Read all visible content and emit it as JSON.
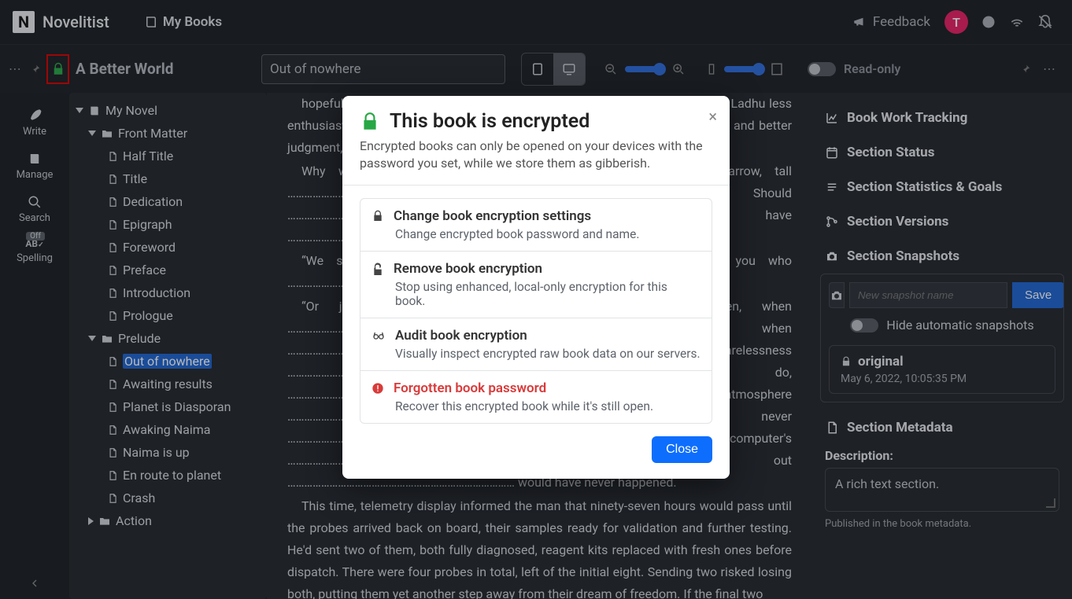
{
  "brand": "Novelitist",
  "my_books": "My Books",
  "feedback": "Feedback",
  "avatar_initial": "T",
  "book_title": "A Better World",
  "chapter_field": "Out of nowhere",
  "readonly_label": "Read-only",
  "rail": {
    "write": "Write",
    "manage": "Manage",
    "search": "Search",
    "spelling": "Spelling",
    "spelling_badge": "Off"
  },
  "tree": [
    {
      "type": "book",
      "label": "My Novel",
      "depth": 0
    },
    {
      "type": "folder",
      "label": "Front Matter",
      "depth": 1
    },
    {
      "type": "doc",
      "label": "Half Title",
      "depth": 2
    },
    {
      "type": "doc",
      "label": "Title",
      "depth": 2
    },
    {
      "type": "doc",
      "label": "Dedication",
      "depth": 2
    },
    {
      "type": "doc",
      "label": "Epigraph",
      "depth": 2
    },
    {
      "type": "doc",
      "label": "Foreword",
      "depth": 2
    },
    {
      "type": "doc",
      "label": "Preface",
      "depth": 2
    },
    {
      "type": "doc",
      "label": "Introduction",
      "depth": 2
    },
    {
      "type": "doc",
      "label": "Prologue",
      "depth": 2
    },
    {
      "type": "folder",
      "label": "Prelude",
      "depth": 1
    },
    {
      "type": "doc",
      "label": "Out of nowhere",
      "depth": 2,
      "selected": true
    },
    {
      "type": "doc",
      "label": "Awaiting results",
      "depth": 2
    },
    {
      "type": "doc",
      "label": "Planet is Diasporan",
      "depth": 2
    },
    {
      "type": "doc",
      "label": "Awaking Naima",
      "depth": 2
    },
    {
      "type": "doc",
      "label": "Naima is up",
      "depth": 2
    },
    {
      "type": "doc",
      "label": "En route to planet",
      "depth": 2
    },
    {
      "type": "doc",
      "label": "Crash",
      "depth": 2
    },
    {
      "type": "folder",
      "label": "Action",
      "depth": 1,
      "collapsed": true
    }
  ],
  "content_paragraphs": [
    "hopefulness and in more frequent, and more honest, reality checks. It made Ladhu less enthusiastic, that was hard to miss, but Naima never let the hope completely, and better judgment, the time.",
    "Why wait ……………………………………………………………………………… pacing the narrow, tall ………………………………………………………………………… trying to avoid. Should …………………………………………………………………… movement may have ………………………………………………………………………… somehow slipped through.",
    "“We should …………………………………………………………………… as long as it's you who ……………………………………………………………………… of it,” she would add.",
    "“Or just ………………………………………………………………………… at least then, when ……………………………………………………………………… after the eleventh, when ………………………………………………………………… and adult carelessness ……………………………………………………………… something he did do, …………………………………………………………………… the lower atmosphere ……………………………………………………………………… resulted in the never …………………………………………………………………… in the computer's ……………………………………………………………………… It had turned out ……………………………………………………………………… would have never happened.",
    "This time, telemetry display informed the man that ninety-seven hours would pass until the probes arrived back on board, their samples ready for validation and further testing. He'd sent two of them, both fully diagnosed, reagent kits replaced with fresh ones before dispatch. There were four probes in total, left of the initial eight. Sending two risked losing both, putting them yet another step away from their dream of freedom. If the final two"
  ],
  "right": {
    "tracking": "Book Work Tracking",
    "status": "Section Status",
    "stats": "Section Statistics & Goals",
    "versions": "Section Versions",
    "snapshots": "Section Snapshots",
    "snapshot_placeholder": "New snapshot name",
    "save": "Save",
    "hide_auto": "Hide automatic snapshots",
    "snap_name": "original",
    "snap_date": "May 6, 2022, 10:05:35 PM",
    "metadata": "Section Metadata",
    "desc_label": "Description:",
    "desc_value": "A rich text section.",
    "pub_note": "Published in the book metadata."
  },
  "modal": {
    "title": "This book is encrypted",
    "subtitle": "Encrypted books can only be opened on your devices with the password you set, while we store them as gibberish.",
    "o1_t": "Change book encryption settings",
    "o1_d": "Change encrypted book password and name.",
    "o2_t": "Remove book encryption",
    "o2_d": "Stop using enhanced, local-only encryption for this book.",
    "o3_t": "Audit book encryption",
    "o3_d": "Visually inspect encrypted raw book data on our servers.",
    "o4_t": "Forgotten book password",
    "o4_d": "Recover this encrypted book while it's still open.",
    "close": "Close"
  }
}
